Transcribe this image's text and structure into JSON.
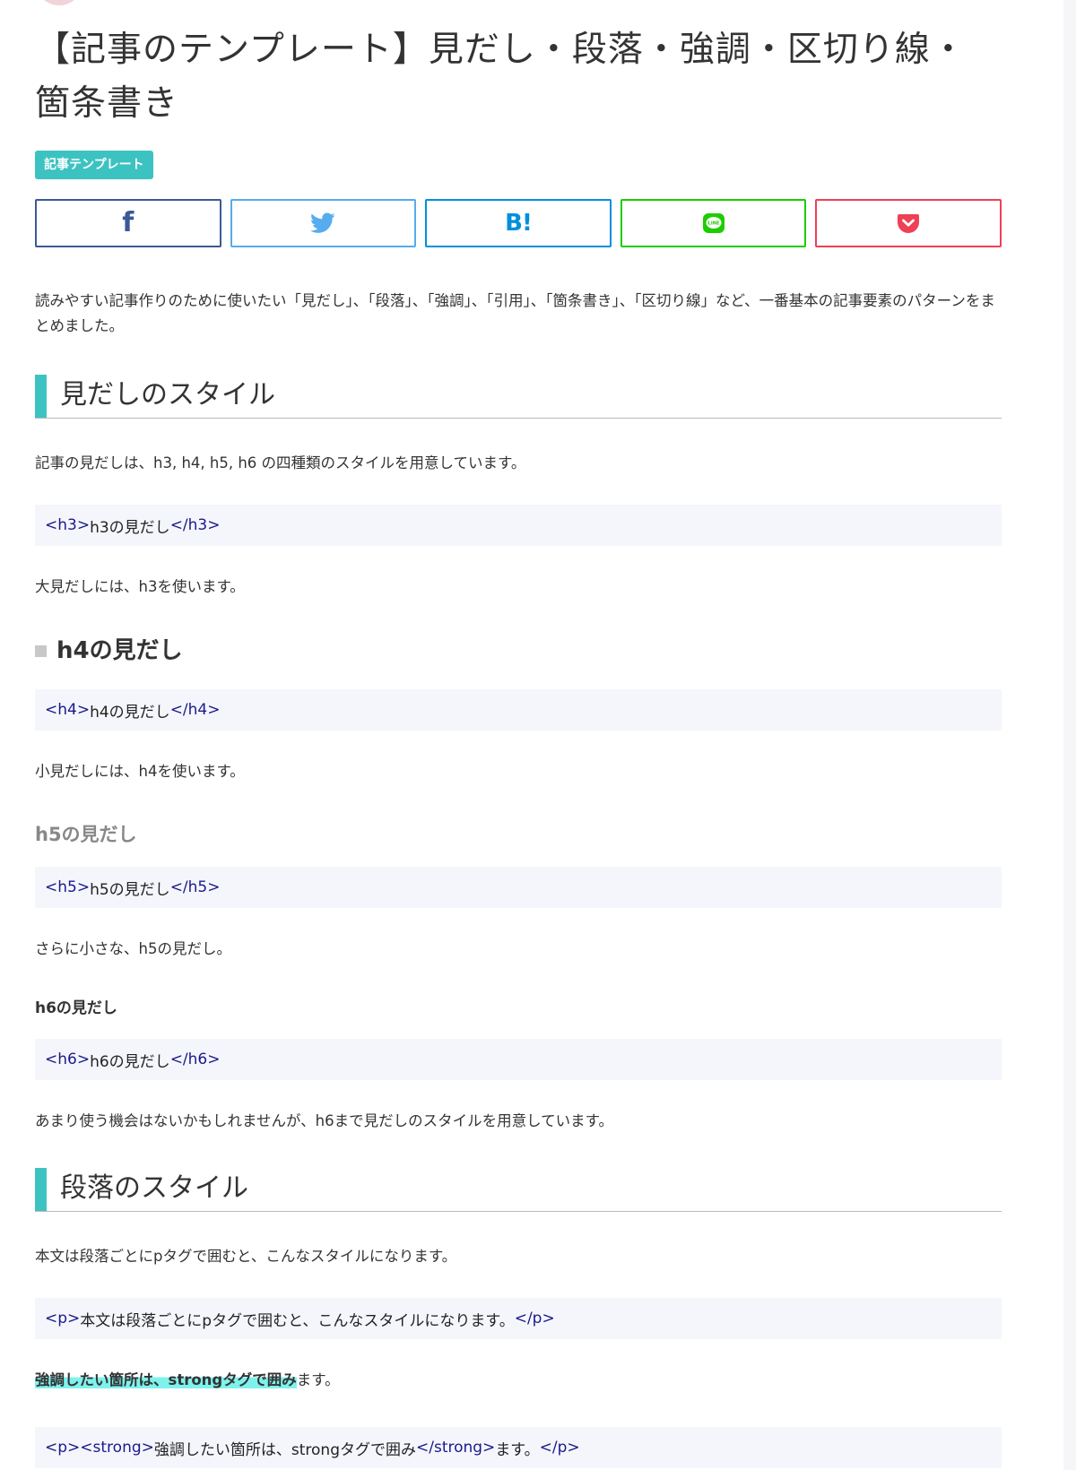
{
  "article": {
    "title": "【記事のテンプレート】見だし・段落・強調・区切り線・箇条書き",
    "category_tag": "記事テンプレート",
    "intro": "読みやすい記事作りのために使いたい「見だし」、「段落」、「強調」、「引用」、「箇条書き」、「区切り線」など、一番基本の記事要素のパターンをまとめました。"
  },
  "share": {
    "buttons": [
      {
        "service": "facebook",
        "icon": "facebook-icon",
        "color": "#3b5998"
      },
      {
        "service": "twitter",
        "icon": "twitter-icon",
        "color": "#55acee"
      },
      {
        "service": "hatena",
        "icon": "hatena-bookmark-icon",
        "label": "B!",
        "color": "#008fde"
      },
      {
        "service": "line",
        "icon": "line-icon",
        "label": "LINE",
        "color": "#1dcd00"
      },
      {
        "service": "pocket",
        "icon": "pocket-icon",
        "color": "#ef4056"
      }
    ]
  },
  "headings_section": {
    "title": "見だしのスタイル",
    "description": "記事の見だしは、h3, h4, h5, h6 の四種類のスタイルを用意しています。",
    "h3": {
      "code_open": "<h3>",
      "code_text": "h3の見だし",
      "code_close": "</h3>",
      "note": "大見だしには、h3を使います。"
    },
    "h4": {
      "sample": "h4の見だし",
      "code_open": "<h4>",
      "code_text": "h4の見だし",
      "code_close": "</h4>",
      "note": "小見だしには、h4を使います。"
    },
    "h5": {
      "sample": "h5の見だし",
      "code_open": "<h5>",
      "code_text": "h5の見だし",
      "code_close": "</h5>",
      "note": "さらに小さな、h5の見だし。"
    },
    "h6": {
      "sample": "h6の見だし",
      "code_open": "<h6>",
      "code_text": "h6の見だし",
      "code_close": "</h6>",
      "note": "あまり使う機会はないかもしれませんが、h6まで見だしのスタイルを用意しています。"
    }
  },
  "paragraph_section": {
    "title": "段落のスタイル",
    "description": "本文は段落ごとにpタグで囲むと、こんなスタイルになります。",
    "code_open": "<p>",
    "code_text": "本文は段落ごとにpタグで囲むと、こんなスタイルになります。",
    "code_close": "</p>",
    "emphasis_text": "強調したい箇所は、strongタグで囲み",
    "emphasis_tail": "ます。",
    "strong_code": {
      "p_open": "<p>",
      "strong_open": "<strong>",
      "strong_text": "強調したい箇所は、strongタグで囲み",
      "strong_close": "</strong>",
      "tail": "ます。",
      "p_close": "</p>"
    }
  },
  "colors": {
    "accent": "#3cc3c1",
    "highlight": "#7ff2ed",
    "code_bg": "#f5f6fc",
    "code_tag": "#1a1a8a"
  }
}
